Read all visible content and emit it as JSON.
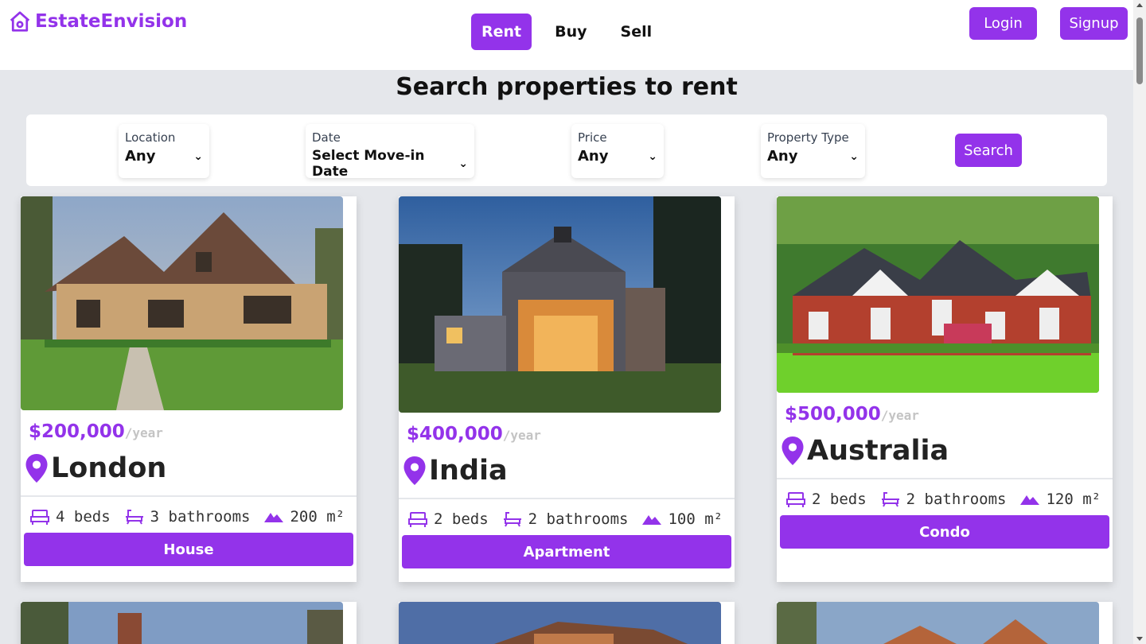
{
  "brand": {
    "name": "EstateEnvision"
  },
  "nav": {
    "tabs": [
      {
        "label": "Rent",
        "active": true
      },
      {
        "label": "Buy"
      },
      {
        "label": "Sell"
      }
    ],
    "login": "Login",
    "signup": "Signup"
  },
  "title": "Search properties to rent",
  "filters": [
    {
      "label": "Location",
      "value": "Any"
    },
    {
      "label": "Date",
      "value": "Select Move-in Date"
    },
    {
      "label": "Price",
      "value": "Any"
    },
    {
      "label": "Property Type",
      "value": "Any"
    }
  ],
  "search_label": "Search",
  "colors": {
    "accent": "#9333ea"
  },
  "listings": [
    {
      "price": "$200,000",
      "period": "/year",
      "city": "London",
      "beds": "4 beds",
      "baths": "3 bathrooms",
      "area": "200 m²",
      "type": "House"
    },
    {
      "price": "$400,000",
      "period": "/year",
      "city": "India",
      "beds": "2 beds",
      "baths": "2 bathrooms",
      "area": "100 m²",
      "type": "Apartment"
    },
    {
      "price": "$500,000",
      "period": "/year",
      "city": "Australia",
      "beds": "2 beds",
      "baths": "2 bathrooms",
      "area": "120 m²",
      "type": "Condo"
    }
  ]
}
